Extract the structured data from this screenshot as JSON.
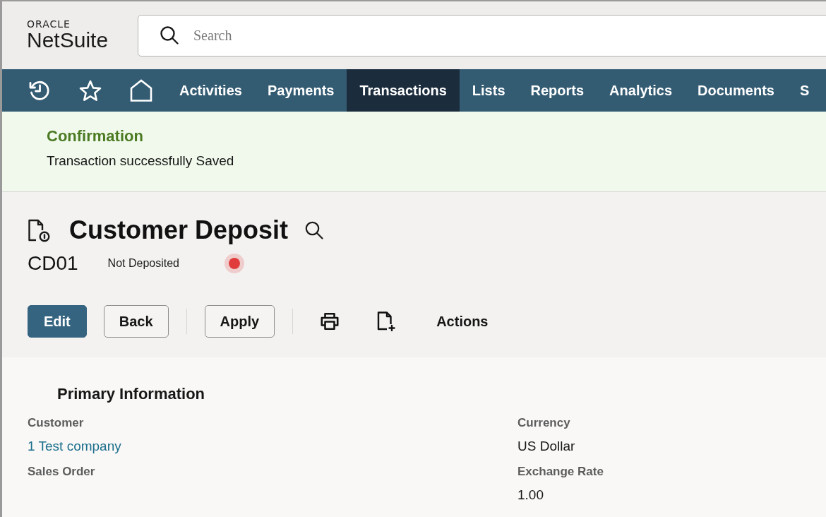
{
  "header": {
    "logo": {
      "caption": "ORACLE",
      "wordmark": "NetSuite"
    },
    "search": {
      "placeholder": "Search"
    }
  },
  "nav": {
    "items": [
      {
        "label": "Activities",
        "selected": false
      },
      {
        "label": "Payments",
        "selected": false
      },
      {
        "label": "Transactions",
        "selected": true
      },
      {
        "label": "Lists",
        "selected": false
      },
      {
        "label": "Reports",
        "selected": false
      },
      {
        "label": "Analytics",
        "selected": false
      },
      {
        "label": "Documents",
        "selected": false
      },
      {
        "label": "S",
        "selected": false
      }
    ]
  },
  "confirmation": {
    "title": "Confirmation",
    "message": "Transaction successfully Saved"
  },
  "record": {
    "title": "Customer Deposit",
    "number": "CD01",
    "status": {
      "label": "Not Deposited",
      "color": "#e03c3c"
    }
  },
  "toolbar": {
    "buttons": [
      {
        "label": "Edit",
        "primary": true
      },
      {
        "label": "Back",
        "primary": false
      },
      {
        "label": "Apply",
        "primary": false
      }
    ],
    "actions_label": "Actions"
  },
  "primary_information": {
    "title": "Primary Information",
    "columns": [
      [
        {
          "label": "Customer",
          "kind": "link",
          "value": "1 Test company"
        },
        {
          "label": "Sales Order",
          "kind": "empty"
        }
      ],
      [
        {
          "label": "Currency",
          "kind": "text",
          "value": "US Dollar"
        },
        {
          "label": "Exchange Rate",
          "kind": "text",
          "value": "1.00"
        }
      ]
    ]
  }
}
